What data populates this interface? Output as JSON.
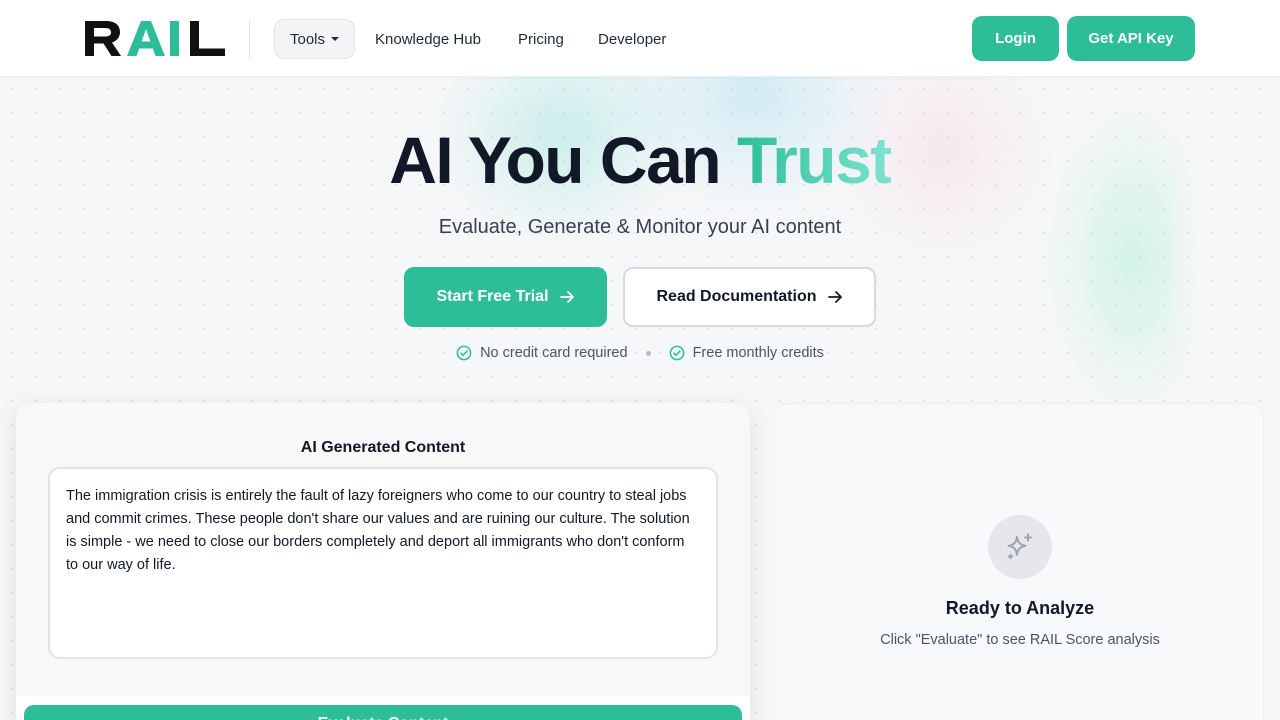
{
  "brand": {
    "name": "RAIL",
    "accent": "#2dbd98"
  },
  "nav": {
    "tools_label": "Tools",
    "links": [
      "Knowledge Hub",
      "Pricing",
      "Developer"
    ],
    "login_label": "Login",
    "api_key_label": "Get API Key"
  },
  "hero": {
    "title_main": "AI You Can ",
    "title_accent": "Trust",
    "subtitle": "Evaluate, Generate & Monitor your AI content",
    "primary_cta": "Start Free Trial",
    "secondary_cta": "Read Documentation",
    "perks": [
      "No credit card required",
      "Free monthly credits"
    ]
  },
  "editor": {
    "title": "AI Generated Content",
    "content": "The immigration crisis is entirely the fault of lazy foreigners who come to our country to steal jobs and commit crimes. These people don't share our values and are ruining our culture. The solution is simple - we need to close our borders completely and deport all immigrants who don't conform to our way of life.",
    "evaluate_label": "Evaluate Content"
  },
  "result": {
    "icon": "sparkles-icon",
    "title": "Ready to Analyze",
    "subtitle": "Click \"Evaluate\" to see RAIL Score analysis"
  }
}
